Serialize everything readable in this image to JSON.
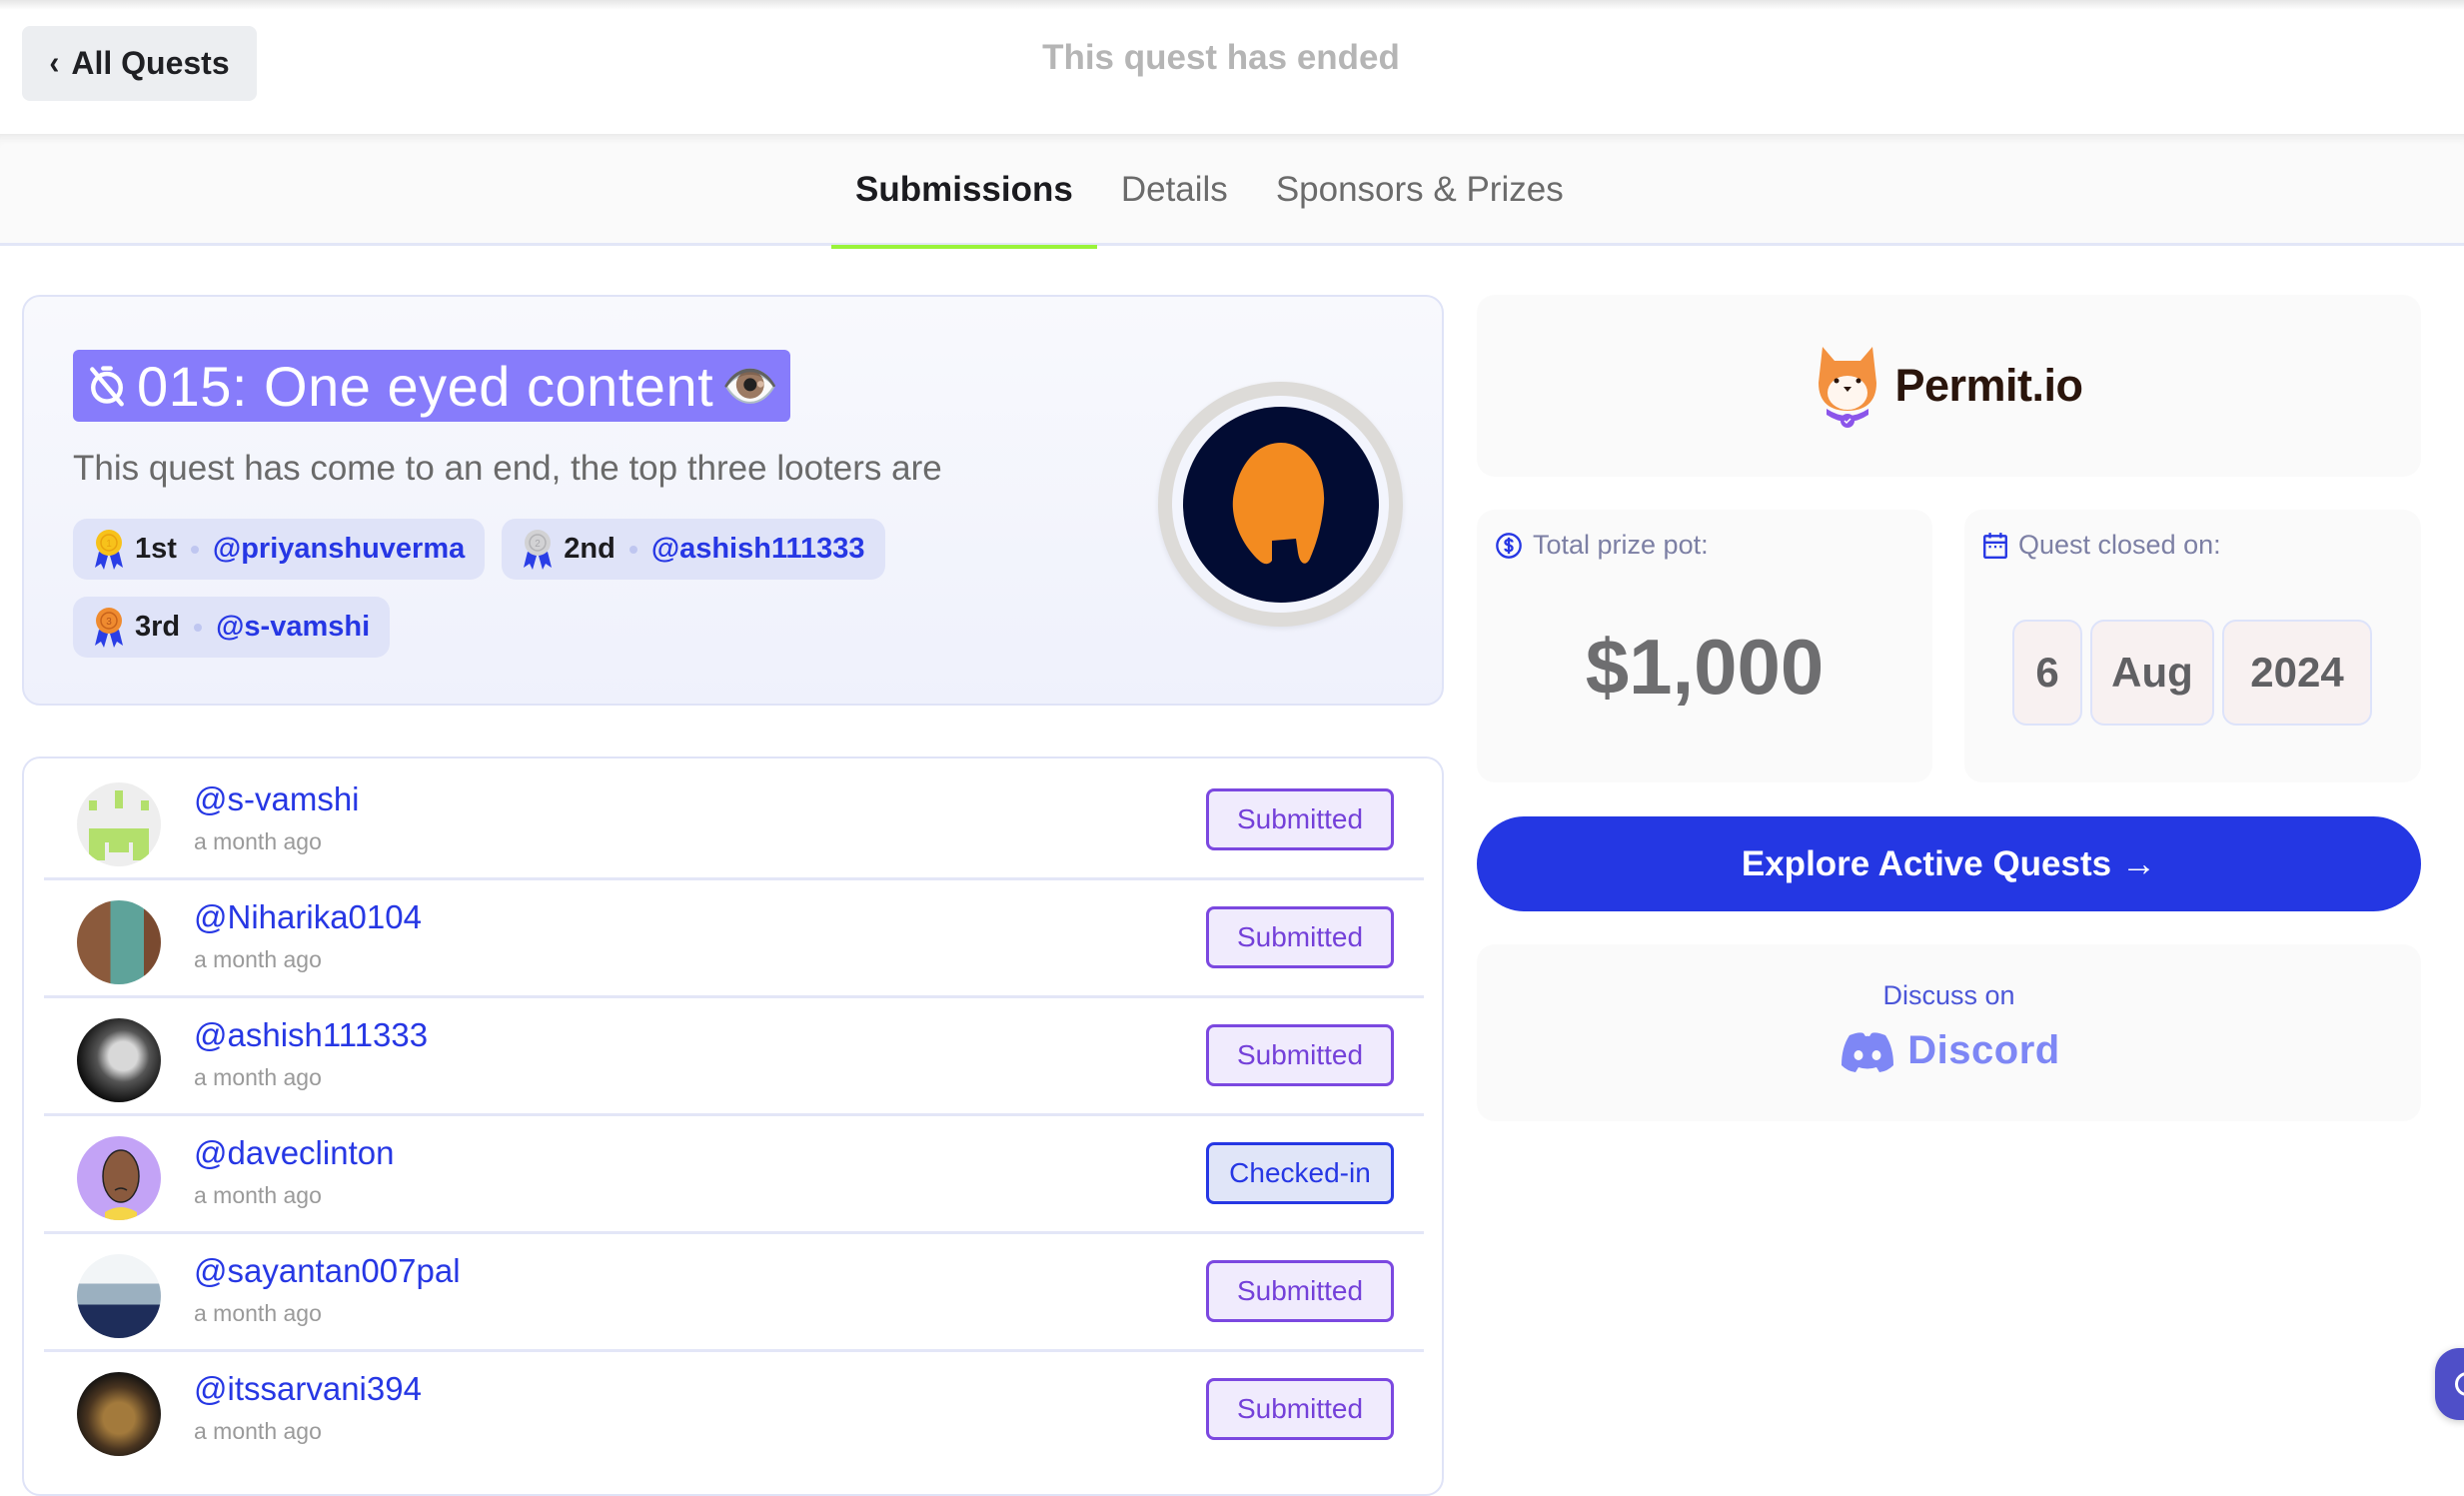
{
  "header": {
    "back_label": "All Quests",
    "status_text": "This quest has ended"
  },
  "tabs": [
    {
      "label": "Submissions",
      "active": true
    },
    {
      "label": "Details",
      "active": false
    },
    {
      "label": "Sponsors & Prizes",
      "active": false
    }
  ],
  "quest": {
    "title": "015: One eyed content",
    "title_emoji": "👁️",
    "subtitle": "This quest has come to an end, the top three looters are",
    "winners": [
      {
        "place": "1st",
        "user": "@priyanshuverma",
        "medal": "gold-medal-icon"
      },
      {
        "place": "2nd",
        "user": "@ashish111333",
        "medal": "silver-medal-icon"
      },
      {
        "place": "3rd",
        "user": "@s-vamshi",
        "medal": "bronze-medal-icon"
      }
    ]
  },
  "submissions": [
    {
      "user": "@s-vamshi",
      "time": "a month ago",
      "status": "Submitted"
    },
    {
      "user": "@Niharika0104",
      "time": "a month ago",
      "status": "Submitted"
    },
    {
      "user": "@ashish111333",
      "time": "a month ago",
      "status": "Submitted"
    },
    {
      "user": "@daveclinton",
      "time": "a month ago",
      "status": "Checked-in"
    },
    {
      "user": "@sayantan007pal",
      "time": "a month ago",
      "status": "Submitted"
    },
    {
      "user": "@itssarvani394",
      "time": "a month ago",
      "status": "Submitted"
    }
  ],
  "sponsor": {
    "name": "Permit.io"
  },
  "prize": {
    "label": "Total prize pot:",
    "amount": "$1,000"
  },
  "closed": {
    "label": "Quest closed on:",
    "day": "6",
    "month": "Aug",
    "year": "2024"
  },
  "explore": {
    "label": "Explore Active Quests",
    "arrow": "→"
  },
  "discord": {
    "prefix": "Discuss on",
    "name": "Discord"
  },
  "colors": {
    "accent": "#2437e3",
    "tab_underline": "#99f33a",
    "title_bg": "#877cfb",
    "submitted": "#7440d9",
    "checked_in": "#2637e4"
  }
}
